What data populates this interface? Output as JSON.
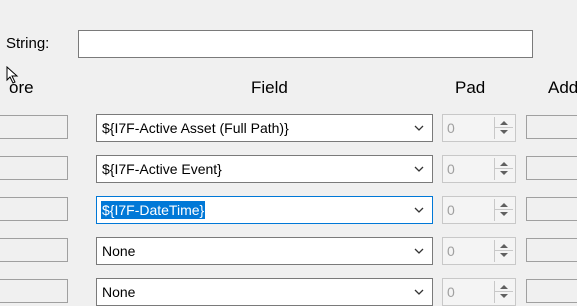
{
  "string_field": {
    "label": "String:",
    "value": ""
  },
  "headers": {
    "pre": "ore",
    "field": "Field",
    "pad": "Pad",
    "add": "Add"
  },
  "rows": [
    {
      "field": "${I7F-Active Asset (Full Path)}",
      "pad": "0",
      "focused": false
    },
    {
      "field": "${I7F-Active Event}",
      "pad": "0",
      "focused": false
    },
    {
      "field": "${I7F-DateTime}",
      "pad": "0",
      "focused": true
    },
    {
      "field": "None",
      "pad": "0",
      "focused": false
    },
    {
      "field": "None",
      "pad": "0",
      "focused": false
    }
  ],
  "icons": {
    "dropdown": "chevron-down-icon",
    "spin_up": "spin-up-icon",
    "spin_down": "spin-down-icon",
    "cursor": "mouse-cursor-icon"
  },
  "colors": {
    "selection": "#0078d7",
    "focus_border": "#0078d7",
    "background": "#f0f0f0"
  }
}
